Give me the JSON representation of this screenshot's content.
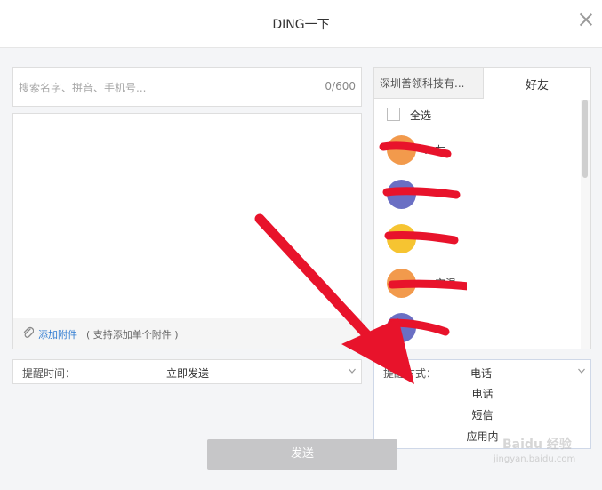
{
  "dialog": {
    "title": "DING一下"
  },
  "search": {
    "placeholder": "搜索名字、拼音、手机号...",
    "counter": "0/600"
  },
  "attachment": {
    "link": "添加附件",
    "note": "( 支持添加单个附件 )"
  },
  "remind_time": {
    "label": "提醒时间：",
    "value": "立即发送"
  },
  "remind_way": {
    "label": "提醒方式：",
    "value": "电话",
    "options": [
      "电话",
      "短信",
      "应用内"
    ]
  },
  "contacts": {
    "tab_org": "深圳善领科技有...",
    "tab_friends": "好友",
    "select_all": "全选",
    "items": [
      {
        "name": "…友",
        "color": "#f29a4c"
      },
      {
        "name": "",
        "color": "#6a6fc4"
      },
      {
        "name": "",
        "color": "#f6c431"
      },
      {
        "name": "…宝温…",
        "color": "#f29a4c"
      },
      {
        "name": "",
        "color": "#6a6fc4"
      }
    ]
  },
  "send": {
    "label": "发送"
  },
  "watermark": {
    "text": "Baidu 经验",
    "url": "jingyan.baidu.com"
  },
  "colors": {
    "link": "#2f7bd1",
    "redaction": "#e8132b",
    "arrow": "#e8132b",
    "send_disabled": "#c6c6c8"
  }
}
